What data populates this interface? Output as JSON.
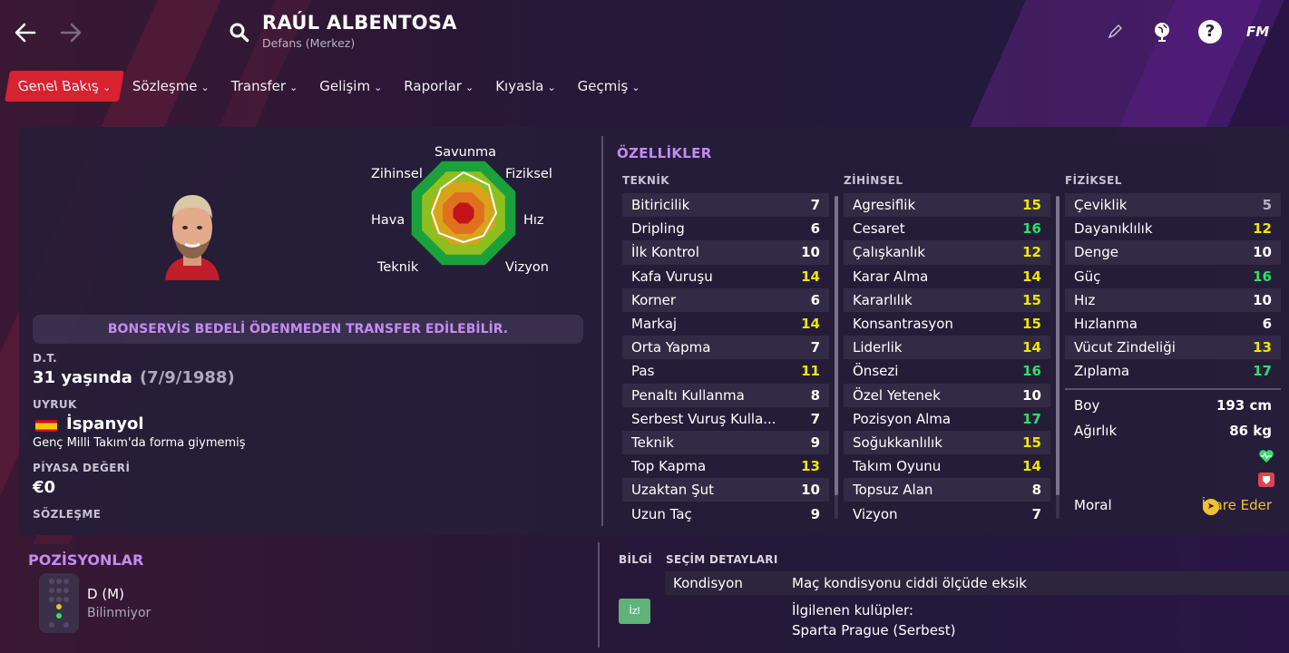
{
  "header": {
    "player_name": "RAÚL ALBENTOSA",
    "player_position": "Defans (Merkez)",
    "help_glyph": "?",
    "logo": "FM"
  },
  "tabs": [
    {
      "label": "Genel Bakış",
      "active": true
    },
    {
      "label": "Sözleşme"
    },
    {
      "label": "Transfer"
    },
    {
      "label": "Gelişim"
    },
    {
      "label": "Raporlar"
    },
    {
      "label": "Kıyasla"
    },
    {
      "label": "Geçmiş"
    }
  ],
  "radar": {
    "labels": {
      "top": "Savunma",
      "top_right": "Fiziksel",
      "right": "Hız",
      "bottom_right": "Vizyon",
      "bottom_left": "Teknik",
      "left": "Hava",
      "top_left": "Zihinsel"
    }
  },
  "profile": {
    "transfer_banner": "BONSERVİS BEDELİ ÖDENMEDEN TRANSFER EDİLEBİLİR.",
    "dob_label": "D.T.",
    "age": "31 yaşında",
    "dob": "(7/9/1988)",
    "nationality_label": "UYRUK",
    "nationality": "İspanyol",
    "youth_caps": "Genç Milli Takım'da forma giymemiş",
    "value_label": "PİYASA DEĞERİ",
    "value": "€0",
    "contract_label": "SÖZLEŞME"
  },
  "attributes": {
    "title": "ÖZELLİKLER",
    "technical": {
      "title": "TEKNİK",
      "items": [
        {
          "name": "Bitiricilik",
          "value": "7"
        },
        {
          "name": "Dripling",
          "value": "6"
        },
        {
          "name": "İlk Kontrol",
          "value": "10"
        },
        {
          "name": "Kafa Vuruşu",
          "value": "14"
        },
        {
          "name": "Korner",
          "value": "6"
        },
        {
          "name": "Markaj",
          "value": "14"
        },
        {
          "name": "Orta Yapma",
          "value": "7"
        },
        {
          "name": "Pas",
          "value": "11"
        },
        {
          "name": "Penaltı Kullanma",
          "value": "8"
        },
        {
          "name": "Serbest Vuruş Kulla...",
          "value": "7"
        },
        {
          "name": "Teknik",
          "value": "9"
        },
        {
          "name": "Top Kapma",
          "value": "13"
        },
        {
          "name": "Uzaktan Şut",
          "value": "10"
        },
        {
          "name": "Uzun Taç",
          "value": "9"
        }
      ]
    },
    "mental": {
      "title": "ZİHİNSEL",
      "items": [
        {
          "name": "Agresiflik",
          "value": "15"
        },
        {
          "name": "Cesaret",
          "value": "16"
        },
        {
          "name": "Çalışkanlık",
          "value": "12"
        },
        {
          "name": "Karar Alma",
          "value": "14"
        },
        {
          "name": "Kararlılık",
          "value": "15"
        },
        {
          "name": "Konsantrasyon",
          "value": "15"
        },
        {
          "name": "Liderlik",
          "value": "14"
        },
        {
          "name": "Önsezi",
          "value": "16"
        },
        {
          "name": "Özel Yetenek",
          "value": "10"
        },
        {
          "name": "Pozisyon Alma",
          "value": "17"
        },
        {
          "name": "Soğukkanlılık",
          "value": "15"
        },
        {
          "name": "Takım Oyunu",
          "value": "14"
        },
        {
          "name": "Topsuz Alan",
          "value": "8"
        },
        {
          "name": "Vizyon",
          "value": "7"
        }
      ]
    },
    "physical": {
      "title": "FİZİKSEL",
      "items": [
        {
          "name": "Çeviklik",
          "value": "5"
        },
        {
          "name": "Dayanıklılık",
          "value": "12"
        },
        {
          "name": "Denge",
          "value": "10"
        },
        {
          "name": "Güç",
          "value": "16"
        },
        {
          "name": "Hız",
          "value": "10"
        },
        {
          "name": "Hızlanma",
          "value": "6"
        },
        {
          "name": "Vücut Zindeliği",
          "value": "13"
        },
        {
          "name": "Zıplama",
          "value": "17"
        }
      ],
      "height_label": "Boy",
      "height": "193 cm",
      "weight_label": "Ağırlık",
      "weight": "86 kg",
      "morale_label": "Moral",
      "morale": "İdare Eder",
      "morale_glyph": "➤"
    }
  },
  "positions": {
    "title": "POZİSYONLAR",
    "position": "D (M)",
    "familiarity": "Bilinmiyor"
  },
  "info_tabs": {
    "tab1": "BİLGİ",
    "tab2": "SEÇİM DETAYLARI",
    "condition_label": "Kondisyon",
    "condition_value": "Maç kondisyonu ciddi ölçüde eksik",
    "scout_button": "İzl",
    "interested_label": "İlgilenen kulüpler:",
    "interested_value": "Sparta Prague (Serbest)"
  },
  "colors": {
    "accent": "#d7222f",
    "purple_title": "#c28cf0",
    "val_white": "#ffffff",
    "val_yellow": "#f2e600",
    "val_green": "#2ee06a",
    "val_grey": "#b9b2c6"
  }
}
